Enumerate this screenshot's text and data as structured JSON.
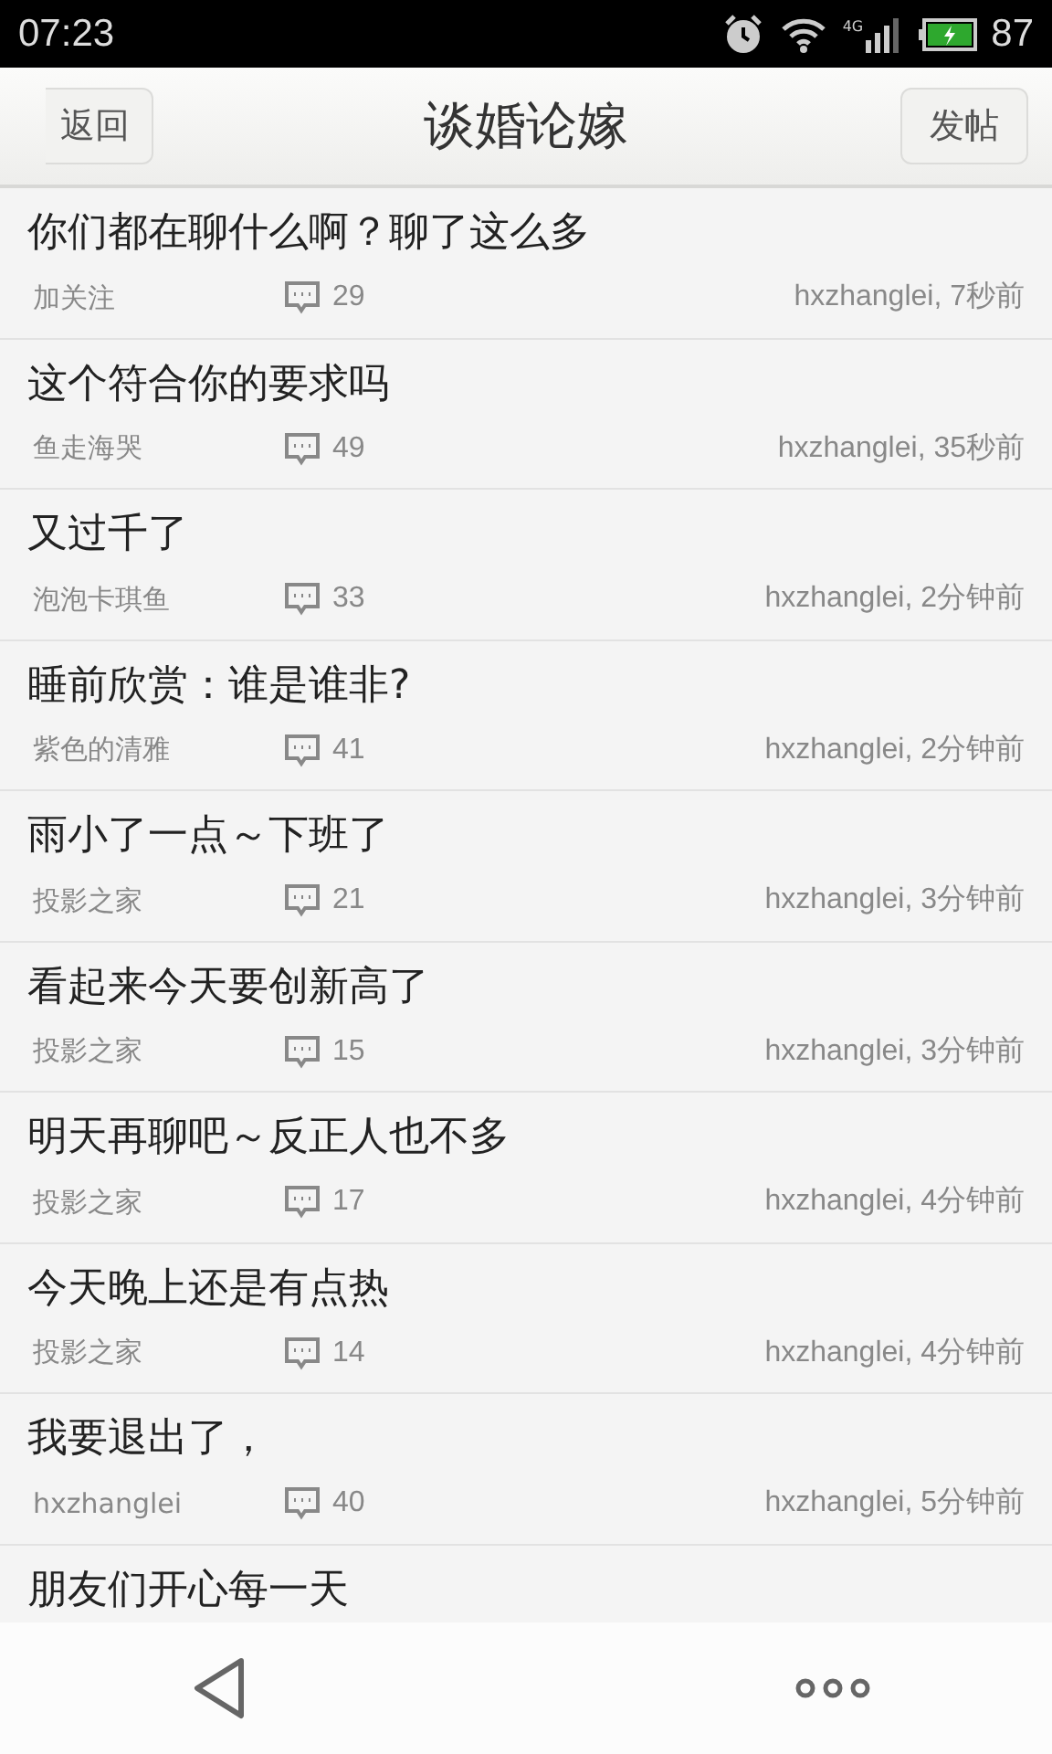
{
  "status_bar": {
    "time": "07:23",
    "network": "4G",
    "battery": "87"
  },
  "header": {
    "back": "返回",
    "title": "谈婚论嫁",
    "post": "发帖"
  },
  "posts": [
    {
      "title": "你们都在聊什么啊？聊了这么多",
      "author": "加关注",
      "comments": "29",
      "meta": "hxzhanglei, 7秒前"
    },
    {
      "title": "这个符合你的要求吗",
      "author": "鱼走海哭",
      "comments": "49",
      "meta": "hxzhanglei, 35秒前"
    },
    {
      "title": "又过千了",
      "author": "泡泡卡琪鱼",
      "comments": "33",
      "meta": "hxzhanglei, 2分钟前"
    },
    {
      "title": "睡前欣赏：谁是谁非?",
      "author": "紫色的清雅",
      "comments": "41",
      "meta": "hxzhanglei, 2分钟前"
    },
    {
      "title": "雨小了一点～下班了",
      "author": "投影之家",
      "comments": "21",
      "meta": "hxzhanglei, 3分钟前"
    },
    {
      "title": "看起来今天要创新高了",
      "author": "投影之家",
      "comments": "15",
      "meta": "hxzhanglei, 3分钟前"
    },
    {
      "title": "明天再聊吧～反正人也不多",
      "author": "投影之家",
      "comments": "17",
      "meta": "hxzhanglei, 4分钟前"
    },
    {
      "title": "今天晚上还是有点热",
      "author": "投影之家",
      "comments": "14",
      "meta": "hxzhanglei, 4分钟前"
    },
    {
      "title": "我要退出了，",
      "author": "hxzhanglei",
      "comments": "40",
      "meta": "hxzhanglei, 5分钟前"
    },
    {
      "title": "朋友们开心每一天"
    }
  ]
}
